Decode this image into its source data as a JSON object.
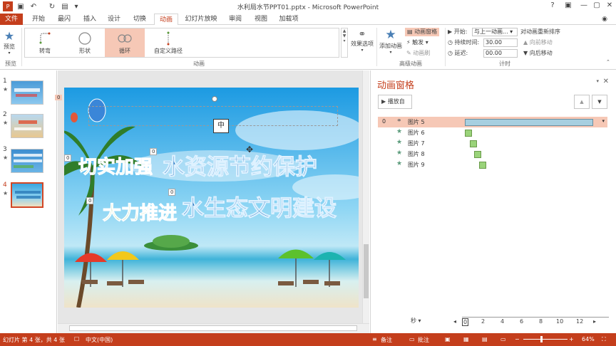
{
  "window": {
    "title": "水利局水节PPT01.pptx - Microsoft PowerPoint",
    "help": "?",
    "controls": [
      "—",
      "▢",
      "✕"
    ]
  },
  "tabs": [
    {
      "label": "文件"
    },
    {
      "label": "开始"
    },
    {
      "label": "最闪"
    },
    {
      "label": "插入"
    },
    {
      "label": "设计"
    },
    {
      "label": "切换"
    },
    {
      "label": "动画"
    },
    {
      "label": "幻灯片放映"
    },
    {
      "label": "审阅"
    },
    {
      "label": "视图"
    },
    {
      "label": "加载项"
    }
  ],
  "ribbon": {
    "preview_label": "预览",
    "preview_group": "预览",
    "gallery": [
      {
        "label": "转弯"
      },
      {
        "label": "形状"
      },
      {
        "label": "循环"
      },
      {
        "label": "自定义路径"
      }
    ],
    "animation_group": "动画",
    "effect_options": "效果选项",
    "add_animation": "添加动画",
    "anim_pane_btn": "动画窗格",
    "trigger": "触发",
    "anim_painter": "动画刷",
    "advanced_group": "高级动画",
    "start_label": "开始:",
    "start_value": "与上一动画...",
    "duration_label": "持续时间:",
    "duration_value": "30.00",
    "delay_label": "延迟:",
    "delay_value": "00.00",
    "timing_group": "计时",
    "reorder_title": "对动画重新排序",
    "move_earlier": "向前移动",
    "move_later": "向后移动"
  },
  "thumbnails": [
    {
      "num": "1",
      "star": "★"
    },
    {
      "num": "2",
      "star": "★"
    },
    {
      "num": "3",
      "star": "★"
    },
    {
      "num": "4",
      "star": "★"
    }
  ],
  "slide": {
    "line1_a": "切实加强",
    "line1_b": "水资源节约保护",
    "line2_a": "大力推进",
    "line2_b": "水生态文明建设",
    "center_tag": "中",
    "tags": [
      "0",
      "0",
      "0",
      "0",
      "0"
    ]
  },
  "anim_pane": {
    "title": "动画窗格",
    "play_label": "播放自",
    "rows": [
      {
        "num": "0",
        "name": "图片 5",
        "start": 0.0,
        "duration": 1.0
      },
      {
        "num": "",
        "name": "图片 6",
        "start": 0.0,
        "duration": 0.05
      },
      {
        "num": "",
        "name": "图片 7",
        "start": 0.04,
        "duration": 0.05
      },
      {
        "num": "",
        "name": "图片 8",
        "start": 0.07,
        "duration": 0.05
      },
      {
        "num": "",
        "name": "图片 9",
        "start": 0.11,
        "duration": 0.05
      }
    ],
    "sec_label": "秒 ▾",
    "ticks": [
      "0",
      "2",
      "4",
      "6",
      "8",
      "10",
      "12"
    ]
  },
  "status": {
    "slide_info": "幻灯片 第 4 张，共 4 张",
    "language": "中文(中国)",
    "notes": "备注",
    "comments": "批注",
    "zoom": "64%"
  },
  "colors": {
    "accent": "#c43e1c",
    "selection": "#f6c8b6"
  }
}
